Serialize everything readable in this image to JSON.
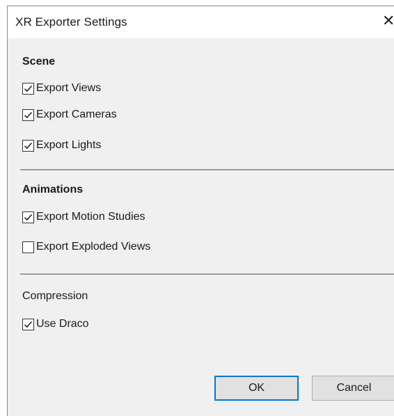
{
  "window": {
    "title": "XR Exporter Settings",
    "close_glyph": "✕",
    "close_icon": "close-icon"
  },
  "scene": {
    "title": "Scene",
    "options": [
      {
        "label": "Export Views",
        "checked": true
      },
      {
        "label": "Export Cameras",
        "checked": true
      },
      {
        "label": "Export Lights",
        "checked": true
      }
    ]
  },
  "animations": {
    "title": "Animations",
    "options": [
      {
        "label": "Export Motion Studies",
        "checked": true
      },
      {
        "label": "Export Exploded Views",
        "checked": false
      }
    ]
  },
  "compression": {
    "title": "Compression",
    "options": [
      {
        "label": "Use Draco",
        "checked": true
      }
    ]
  },
  "buttons": {
    "ok_label": "OK",
    "cancel_label": "Cancel"
  },
  "colors": {
    "dialog_bg": "#f0f0f0",
    "titlebar_bg": "#ffffff",
    "default_button_border": "#0078d7"
  }
}
